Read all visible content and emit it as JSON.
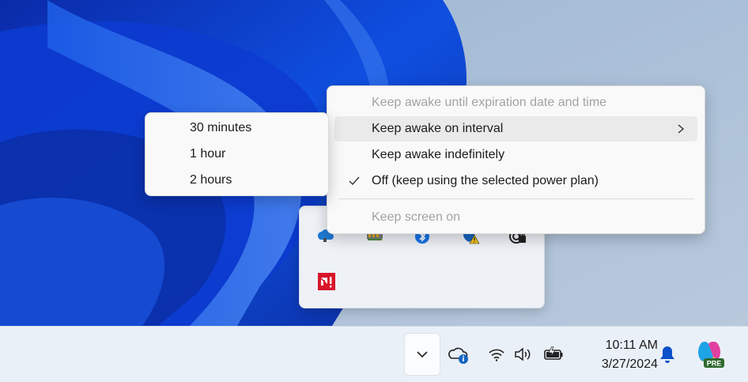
{
  "main_menu": {
    "items": [
      {
        "label": "Keep awake until expiration date and time",
        "state": "disabled"
      },
      {
        "label": "Keep awake on interval",
        "state": "highlighted",
        "has_submenu": true
      },
      {
        "label": "Keep awake indefinitely",
        "state": "normal"
      },
      {
        "label": "Off (keep using the selected power plan)",
        "state": "checked"
      },
      {
        "label": "Keep screen on",
        "state": "disabled"
      }
    ]
  },
  "submenu": {
    "items": [
      {
        "label": "30 minutes"
      },
      {
        "label": "1 hour"
      },
      {
        "label": "2 hours"
      }
    ]
  },
  "taskbar": {
    "time": "10:11 AM",
    "date": "3/27/2024",
    "copilot_badge": "PRE"
  },
  "colors": {
    "wallpaper_blue": "#0a3cc8",
    "highlight_bg": "#eaeaea",
    "disabled_text": "#a3a3a3",
    "taskbar_bg": "#eaf0f8"
  },
  "tray_icons": [
    "onedrive-icon",
    "memory-chip-icon",
    "bluetooth-icon",
    "defender-warning-icon",
    "vpn-lock-icon",
    "amd-warning-icon"
  ]
}
